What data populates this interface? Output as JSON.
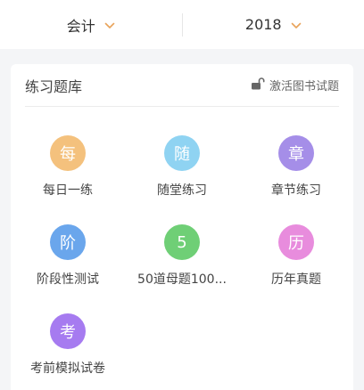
{
  "filters": {
    "subject": {
      "label": "会计"
    },
    "year": {
      "label": "2018"
    }
  },
  "panel": {
    "title": "练习题库",
    "activate_link": "激活图书试题"
  },
  "items": [
    {
      "glyph": "每",
      "label": "每日一练",
      "color": "#f4c17d",
      "icon": "daily-practice-icon"
    },
    {
      "glyph": "随",
      "label": "随堂练习",
      "color": "#8fd3f2",
      "icon": "class-practice-icon"
    },
    {
      "glyph": "章",
      "label": "章节练习",
      "color": "#a58ee8",
      "icon": "chapter-practice-icon"
    },
    {
      "glyph": "阶",
      "label": "阶段性测试",
      "color": "#6aa6ec",
      "icon": "stage-test-icon"
    },
    {
      "glyph": "5",
      "label": "50道母题100...",
      "color": "#6fcf76",
      "icon": "fifty-questions-icon"
    },
    {
      "glyph": "历",
      "label": "历年真题",
      "color": "#e88cdd",
      "icon": "past-exams-icon"
    },
    {
      "glyph": "考",
      "label": "考前模拟试卷",
      "color": "#a67bf0",
      "icon": "mock-exam-icon"
    }
  ],
  "colors": {
    "accent_chevron": "#e8a35a",
    "background": "#f4f5f7"
  }
}
